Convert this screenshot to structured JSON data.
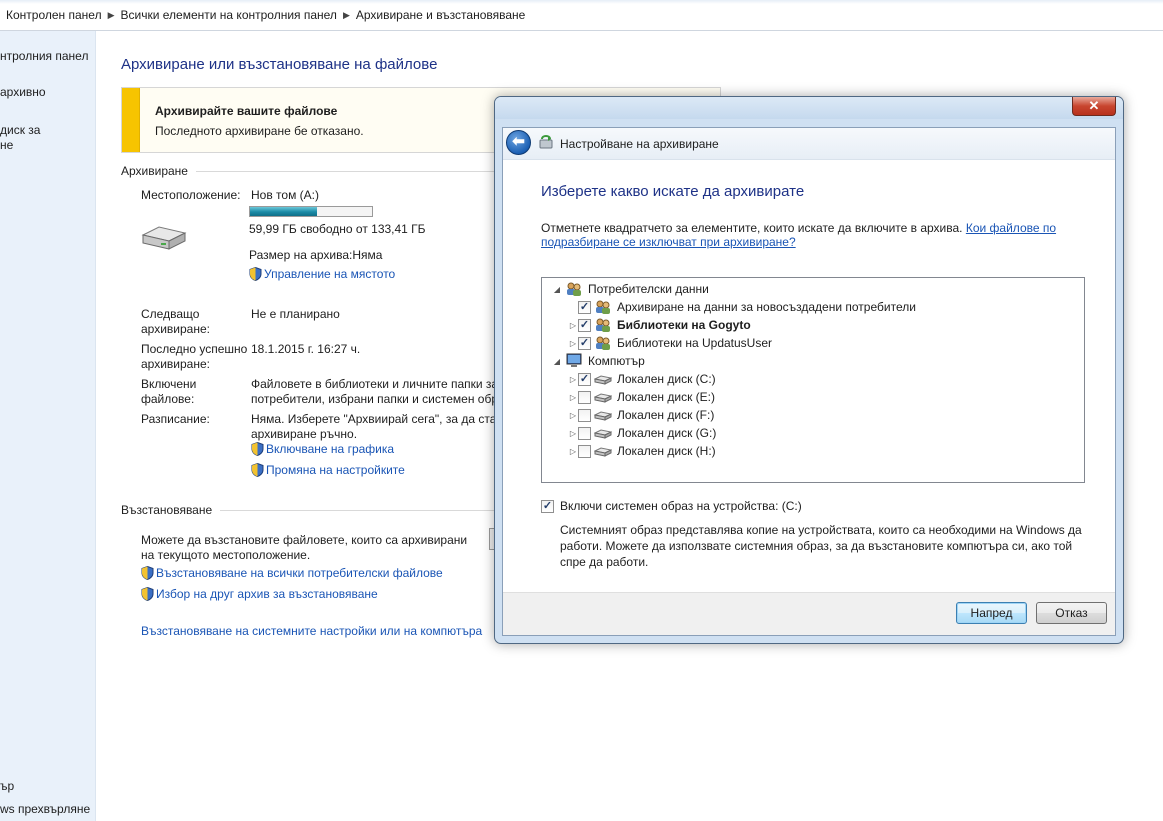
{
  "breadcrumb": [
    "Контролен панел",
    "Всички елементи на контролния панел",
    "Архивиране и възстановяване"
  ],
  "leftnav": {
    "top_items": [
      "нтролния панел",
      "архивно",
      "диск за",
      "не"
    ],
    "bottom_items": [
      "ър",
      "ws прехвърляне"
    ]
  },
  "main": {
    "title": "Архивиране или възстановяване на файлове",
    "banner": {
      "title": "Архивирайте вашите файлове",
      "text": "Последното архивиране бе отказано."
    },
    "backup": {
      "section": "Архивиране",
      "location_label": "Местоположение:",
      "location_value": "Нов том (A:)",
      "disk_used_fraction": 0.55,
      "free_text": "59,99 ГБ свободно от 133,41 ГБ",
      "size_text": "Размер на архива:Няма",
      "manage_space_link": "Управление на мястото",
      "next_label": "Следващо архивиране:",
      "next_value": "Не е планирано",
      "last_label": "Последно успешно архивиране:",
      "last_value": "18.1.2015 г. 16:27 ч.",
      "contents_label": "Включени файлове:",
      "contents_value_1": "Файловете в библиотеки и личните папки за",
      "contents_value_2": "потребители, избрани папки и системен обр",
      "schedule_label": "Разписание:",
      "schedule_value_1": "Няма. Изберете \"Архвиирай сега\", за да стар",
      "schedule_value_2": "архивиране ръчно.",
      "turn_on_schedule_link": "Включване на графика",
      "change_settings_link": "Промяна на настройките"
    },
    "restore": {
      "section": "Възстановяване",
      "text_1": "Можете да възстановите файловете, които са архивирани",
      "text_2": "на текущото местоположение.",
      "restore_all_link": "Възстановяване на всички потребителски файлове",
      "select_other_link": "Избор на друг архив за възстановяване",
      "system_settings_link": "Възстановяване на системните настройки или на компютъра"
    }
  },
  "dialog": {
    "close_glyph": "✕",
    "wizard_title": "Настройване на архивиране",
    "heading": "Изберете какво искате да архивирате",
    "instruction": "Отметнете квадратчето за елементите, които искате да включите в архива.",
    "instruction_link": "Кои файлове по подразбиране се изключват при архивиране?",
    "tree": [
      {
        "label": "Потребителски данни",
        "level": 0,
        "expander": "◢",
        "checkbox": false,
        "checked": false,
        "bold": false,
        "icon": "users-icon"
      },
      {
        "label": "Архивиране на данни за новосъздадени потребители",
        "level": 1,
        "expander": "",
        "checkbox": true,
        "checked": true,
        "bold": false,
        "icon": "users-icon"
      },
      {
        "label": "Библиотеки на Gogyto",
        "level": 1,
        "expander": "▷",
        "checkbox": true,
        "checked": true,
        "bold": true,
        "icon": "users-icon"
      },
      {
        "label": "Библиотеки на UpdatusUser",
        "level": 1,
        "expander": "▷",
        "checkbox": true,
        "checked": true,
        "bold": false,
        "icon": "users-icon"
      },
      {
        "label": "Компютър",
        "level": 0,
        "expander": "◢",
        "checkbox": false,
        "checked": false,
        "bold": false,
        "icon": "computer-icon"
      },
      {
        "label": "Локален диск (C:)",
        "level": 1,
        "expander": "▷",
        "checkbox": true,
        "checked": true,
        "bold": false,
        "icon": "drive-icon"
      },
      {
        "label": "Локален диск (E:)",
        "level": 1,
        "expander": "▷",
        "checkbox": true,
        "checked": false,
        "bold": false,
        "icon": "drive-icon"
      },
      {
        "label": "Локален диск (F:)",
        "level": 1,
        "expander": "▷",
        "checkbox": true,
        "checked": false,
        "bold": false,
        "icon": "drive-icon"
      },
      {
        "label": "Локален диск (G:)",
        "level": 1,
        "expander": "▷",
        "checkbox": true,
        "checked": false,
        "bold": false,
        "icon": "drive-icon"
      },
      {
        "label": "Локален диск (H:)",
        "level": 1,
        "expander": "▷",
        "checkbox": true,
        "checked": false,
        "bold": false,
        "icon": "drive-icon"
      }
    ],
    "system_image_label": "Включи системен образ на устройства: (C:)",
    "system_image_checked": true,
    "system_image_desc": "Системният образ представлява копие на устройствата, които са необходими на Windows да работи. Можете да използвате системния образ, за да възстановите компютъра си, ако той спре да работи.",
    "next_button": "Напред",
    "cancel_button": "Отказ"
  }
}
